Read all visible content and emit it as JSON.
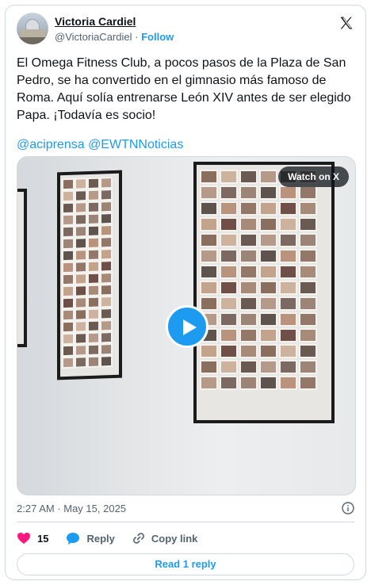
{
  "author": {
    "name": "Victoria Cardiel",
    "handle": "@VictoriaCardiel",
    "separator": "·",
    "follow_label": "Follow"
  },
  "tweet": {
    "text_lines": [
      "El Omega Fitness Club, a pocos pasos de la Plaza de San",
      "Pedro, se ha convertido en el gimnasio más famoso de",
      "Roma. Aquí solía entrenarse León XIV antes de ser elegido",
      "Papa. ¡Todavía es socio!"
    ],
    "mentions": "@aciprensa @EWTNNoticias",
    "timestamp": "2:27 AM · May 15, 2025"
  },
  "media": {
    "watch_label": "Watch on X",
    "play_icon": "play-icon"
  },
  "actions": {
    "likes_count": "15",
    "reply_label": "Reply",
    "copy_link_label": "Copy link"
  },
  "read_reply_label": "Read 1 reply",
  "colors": {
    "accent": "#1d9bf0",
    "like": "#f91880",
    "text": "#0f1419",
    "muted": "#536471",
    "border": "#cfd9de"
  }
}
